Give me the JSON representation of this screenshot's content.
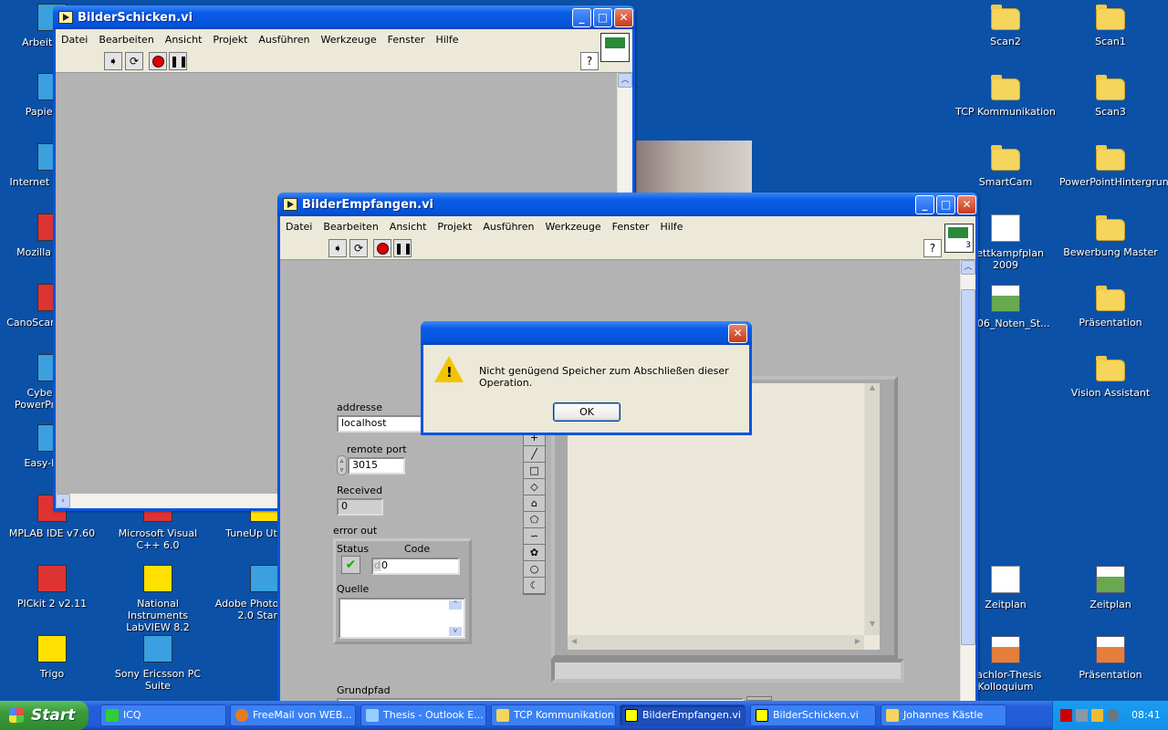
{
  "desktop": {
    "left_icons": [
      {
        "label": "Arbeitsplatz",
        "icon": "computer-icon"
      },
      {
        "label": "Papierkorb",
        "icon": "recycle-bin-icon"
      },
      {
        "label": "Internet Explorer",
        "icon": "internet-explorer-icon"
      },
      {
        "label": "Mozilla Firefox",
        "icon": "firefox-icon"
      },
      {
        "label": "CanoScan Toolbox",
        "icon": "canoscan-icon"
      },
      {
        "label": "CyberLink PowerProducer",
        "icon": "cyberlink-icon"
      },
      {
        "label": "Easy-Photo",
        "icon": "easy-photo-icon"
      },
      {
        "label": "MPLAB IDE v7.60",
        "icon": "mplab-icon"
      },
      {
        "label": "Microsoft Visual C++ 6.0",
        "icon": "visual-cpp-icon"
      },
      {
        "label": "TuneUp Utilities",
        "icon": "tuneup-icon"
      },
      {
        "label": "PICkit 2 v2.11",
        "icon": "pickit-icon"
      },
      {
        "label": "National Instruments LabVIEW 8.2",
        "icon": "labview-icon"
      },
      {
        "label": "Adobe Photo Album 2.0 Starter",
        "icon": "adobe-photo-album-icon"
      },
      {
        "label": "Trigo",
        "icon": "trigo-icon"
      },
      {
        "label": "Sony Ericsson PC Suite",
        "icon": "sony-ericsson-icon"
      }
    ],
    "right_icons": [
      {
        "label": "Scan2",
        "icon": "folder-icon"
      },
      {
        "label": "Scan1",
        "icon": "folder-icon"
      },
      {
        "label": "TCP Kommunikation",
        "icon": "folder-icon"
      },
      {
        "label": "Scan3",
        "icon": "folder-icon"
      },
      {
        "label": "SmartCam",
        "icon": "folder-icon"
      },
      {
        "label": "PowerPointHintergrund",
        "icon": "folder-icon"
      },
      {
        "label": "Wettkampfplan 2009",
        "icon": "text-document-icon"
      },
      {
        "label": "Bewerbung Master",
        "icon": "folder-icon"
      },
      {
        "label": "08.06_Noten_St...",
        "icon": "spreadsheet-icon"
      },
      {
        "label": "Präsentation",
        "icon": "folder-icon"
      },
      {
        "label": "Vision Assistant",
        "icon": "folder-icon"
      },
      {
        "label": "Zeitplan",
        "icon": "image-document-icon"
      },
      {
        "label": "Zeitplan",
        "icon": "spreadsheet-icon"
      },
      {
        "label": "Bachlor-Thesis Kolloquium",
        "icon": "presentation-icon"
      },
      {
        "label": "Präsentation",
        "icon": "presentation-icon"
      }
    ]
  },
  "menu": [
    "Datei",
    "Bearbeiten",
    "Ansicht",
    "Projekt",
    "Ausführen",
    "Werkzeuge",
    "Fenster",
    "Hilfe"
  ],
  "window_send": {
    "title": "BilderSchicken.vi"
  },
  "window_receive": {
    "title": "BilderEmpfangen.vi",
    "connector_pane_number": "3",
    "help_label": "?",
    "panel": {
      "address_label": "addresse",
      "address_value": "localhost",
      "port_label": "remote port",
      "port_value": "3015",
      "received_label": "Received",
      "received_value": "0",
      "error_label": "error out",
      "status_label": "Status",
      "code_label": "Code",
      "code_radix": "d",
      "code_value": "0",
      "source_label": "Quelle",
      "source_value": "",
      "path_label": "Grundpfad"
    }
  },
  "dialog": {
    "message": "Nicht genügend Speicher zum Abschließen dieser Operation.",
    "ok_label": "OK"
  },
  "taskbar": {
    "start_label": "Start",
    "items": [
      {
        "label": "ICQ",
        "active": false
      },
      {
        "label": "FreeMail von WEB...",
        "active": false
      },
      {
        "label": "Thesis - Outlook E...",
        "active": false
      },
      {
        "label": "TCP Kommunikation",
        "active": false
      },
      {
        "label": "BilderEmpfangen.vi",
        "active": true
      },
      {
        "label": "BilderSchicken.vi",
        "active": false
      },
      {
        "label": "Johannes Kästle",
        "active": false
      }
    ],
    "clock": "08:41"
  }
}
